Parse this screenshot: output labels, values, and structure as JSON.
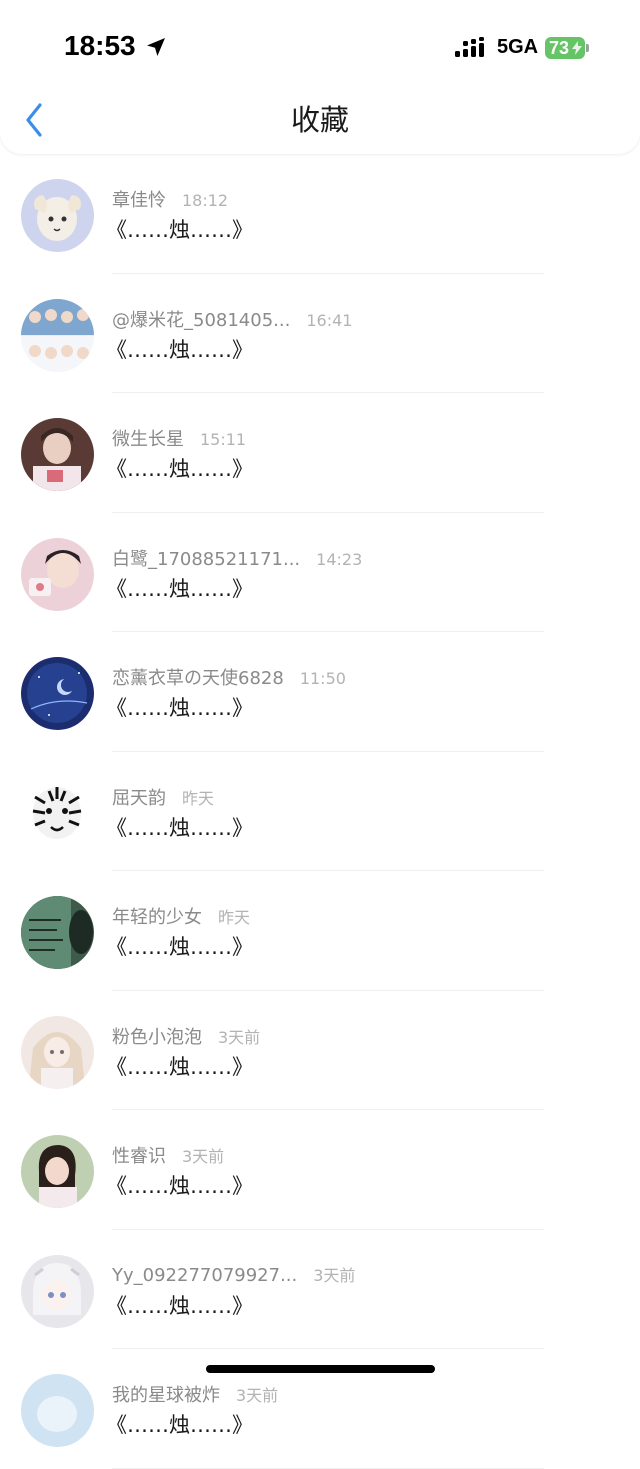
{
  "status_bar": {
    "time": "18:53",
    "network": "5GA",
    "battery": "73",
    "battery_color": "#65c466"
  },
  "nav": {
    "title": "收藏",
    "back_icon": "chevron-left-icon",
    "accent": "#3b8ee8"
  },
  "items": [
    {
      "name": "章佳怜",
      "time": "18:12",
      "message": "《……烛……》"
    },
    {
      "name": "@爆米花_5081405...",
      "time": "16:41",
      "message": "《……烛……》"
    },
    {
      "name": "微生长星",
      "time": "15:11",
      "message": "《……烛……》"
    },
    {
      "name": "白鹭_17088521171...",
      "time": "14:23",
      "message": "《……烛……》"
    },
    {
      "name": "恋薰衣草の天使6828",
      "time": "11:50",
      "message": "《……烛……》"
    },
    {
      "name": "屈天韵",
      "time": "昨天",
      "message": "《……烛……》"
    },
    {
      "name": "年轻的少女",
      "time": "昨天",
      "message": "《……烛……》"
    },
    {
      "name": "粉色小泡泡",
      "time": "3天前",
      "message": "《……烛……》"
    },
    {
      "name": "性睿识",
      "time": "3天前",
      "message": "《……烛……》"
    },
    {
      "name": "Yy_092277079927...",
      "time": "3天前",
      "message": "《……烛……》"
    },
    {
      "name": "我的星球被炸",
      "time": "3天前",
      "message": "《……烛……》"
    }
  ]
}
